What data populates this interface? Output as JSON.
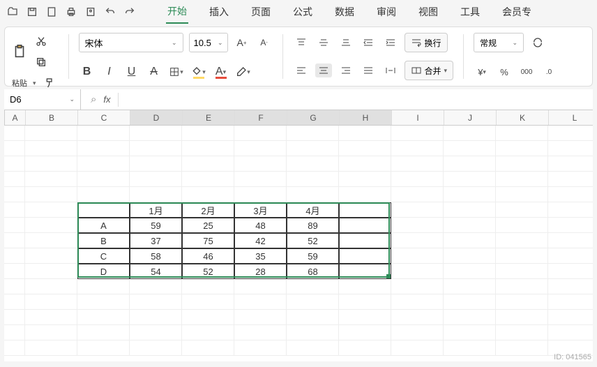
{
  "menu": {
    "tabs": [
      "开始",
      "插入",
      "页面",
      "公式",
      "数据",
      "审阅",
      "视图",
      "工具",
      "会员专"
    ],
    "active": "开始"
  },
  "ribbon": {
    "paste_label": "粘贴",
    "font_name": "宋体",
    "font_size": "10.5",
    "wrap_label": "换行",
    "merge_label": "合并",
    "number_format": "常规"
  },
  "namebox": "D6",
  "fx_label": "fx",
  "search_icon": "⌕",
  "columns": [
    "A",
    "B",
    "C",
    "D",
    "E",
    "F",
    "G",
    "H",
    "I",
    "J",
    "K",
    "L"
  ],
  "chart_data": {
    "type": "table",
    "title": "",
    "row_labels": [
      "A",
      "B",
      "C",
      "D"
    ],
    "col_labels": [
      "1月",
      "2月",
      "3月",
      "4月"
    ],
    "values": [
      [
        59,
        25,
        48,
        89
      ],
      [
        37,
        75,
        42,
        52
      ],
      [
        58,
        46,
        35,
        59
      ],
      [
        54,
        52,
        28,
        68
      ]
    ],
    "cell_origin": {
      "col": "C",
      "row": 6
    },
    "selection": {
      "cols": [
        "D",
        "E",
        "F",
        "G",
        "H"
      ],
      "rows": [
        6
      ]
    }
  },
  "watermark": "ID: 041565"
}
